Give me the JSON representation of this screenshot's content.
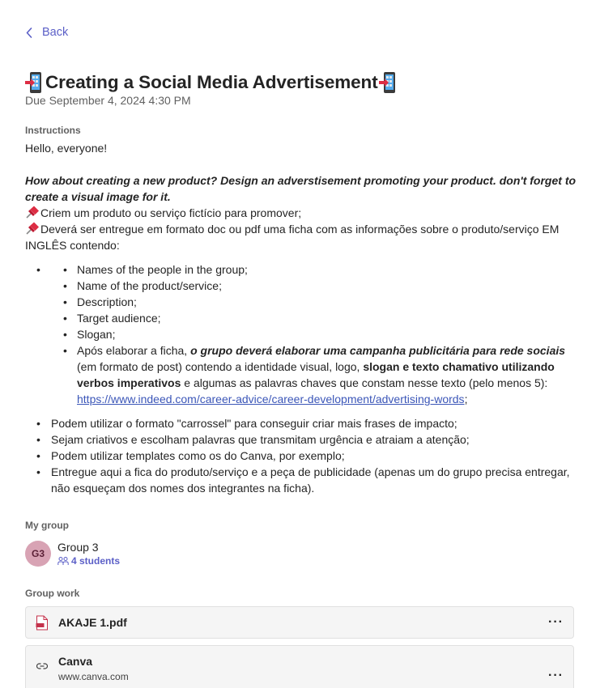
{
  "nav": {
    "back_label": "Back"
  },
  "assignment": {
    "title": "Creating a Social Media Advertisement",
    "due": "Due September 4, 2024 4:30 PM"
  },
  "instructions": {
    "label": "Instructions",
    "greeting": "Hello, everyone!",
    "prompt": "How about creating a new product? Design an adverstisement promoting your product.  don't forget to create a visual image for it.",
    "step1": "Criem um produto ou serviço fictício para promover;",
    "step2": "Deverá ser entregue em formato doc ou pdf uma ficha com as informações sobre o produto/serviço EM INGLÊS contendo:",
    "nested_items": [
      "Names of the people in the group;",
      "Name of the product/service;",
      "Description;",
      "Target audience;",
      "Slogan;"
    ],
    "last_nested": {
      "part1": "Após elaborar a ficha, ",
      "part2_bold_italic": "o grupo deverá elaborar uma campanha publicitária para rede sociais",
      "part3": " (em formato de post) contendo a identidade visual, logo, ",
      "part4_bold": "slogan e texto chamativo utilizando verbos imperativos",
      "part5": " e algumas as palavras chaves que constam nesse texto (pelo menos 5): ",
      "link": "https://www.indeed.com/career-advice/career-development/advertising-words",
      "part6": ";"
    },
    "outer_items": [
      "Podem utilizar o formato \"carrossel\" para conseguir criar mais frases de impacto;",
      "Sejam criativos e escolham palavras que transmitam urgência e atraiam a atenção;",
      "Podem utilizar templates como os do Canva, por exemplo;",
      "Entregue aqui a fica do produto/serviço e a peça de publicidade (apenas um do grupo precisa entregar, não esqueçam dos nomes dos integrantes na ficha)."
    ]
  },
  "my_group": {
    "label": "My group",
    "avatar": "G3",
    "name": "Group 3",
    "students": "4 students"
  },
  "group_work": {
    "label": "Group work",
    "files": [
      {
        "name": "AKAJE 1.pdf",
        "icon": "pdf-file-icon"
      },
      {
        "name": "Canva",
        "subtitle": "www.canva.com",
        "icon": "link-icon"
      }
    ],
    "more_label": "···"
  },
  "colors": {
    "accent": "#5b5fc7",
    "link": "#3b56b8",
    "avatar_bg": "#d8a3b4"
  }
}
